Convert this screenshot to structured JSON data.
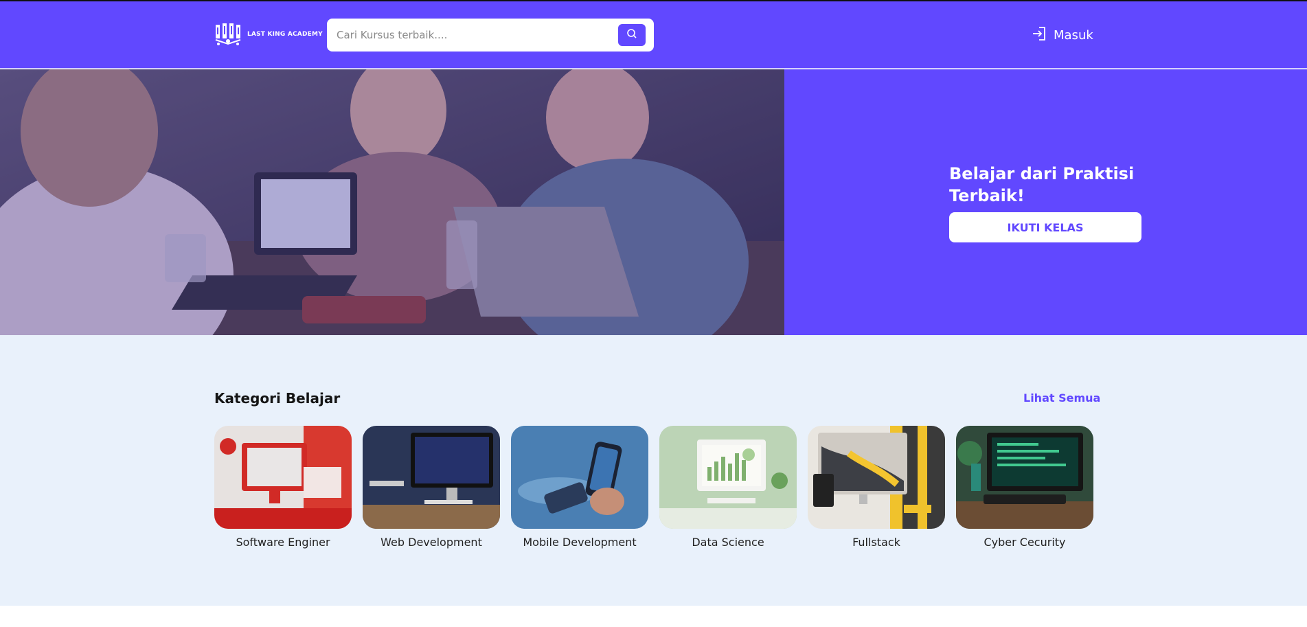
{
  "brand": {
    "name": "LAST KING ACADEMY",
    "primary_color": "#6148ff",
    "background": "#e9f1fb"
  },
  "header": {
    "search": {
      "placeholder": "Cari Kursus terbaik....",
      "value": "",
      "icon": "search-icon"
    },
    "login": {
      "label": "Masuk",
      "icon": "login-icon"
    }
  },
  "hero": {
    "headline": "Belajar dari Praktisi Terbaik!",
    "cta_label": "IKUTI KELAS"
  },
  "categories": {
    "title": "Kategori Belajar",
    "see_all_label": "Lihat Semua",
    "items": [
      {
        "label": "Software Enginer"
      },
      {
        "label": "Web Development"
      },
      {
        "label": "Mobile Development"
      },
      {
        "label": "Data Science"
      },
      {
        "label": "Fullstack"
      },
      {
        "label": "Cyber Cecurity"
      }
    ]
  }
}
